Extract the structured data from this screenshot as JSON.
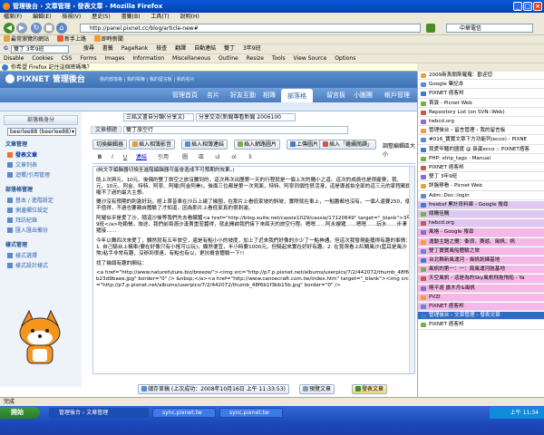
{
  "window": {
    "title": "管理後台 › 文章管理 › 發表文章 - Mozilla Firefox"
  },
  "menu": [
    "檔案(F)",
    "編輯(E)",
    "檢視(V)",
    "歷史(S)",
    "書籤(B)",
    "工具(T)",
    "說明(H)"
  ],
  "nav": {
    "url": "http://panel.pixnet.cc/blog/article-new#",
    "search_engine": "中華電信"
  },
  "bookmarks_toolbar": [
    "最常瀏覽的網站",
    "新手上路",
    "即時新聞"
  ],
  "google_toolbar": {
    "search": "雙丁 3年9班",
    "items": [
      "搜尋",
      "書籤",
      "PageRank",
      "檢查",
      "翻譯",
      "自動連結",
      "雙丁",
      "3年9班"
    ]
  },
  "webdev_toolbar": [
    "Disable",
    "Cookies",
    "CSS",
    "Forms",
    "Images",
    "Information",
    "Miscellaneous",
    "Outline",
    "Resize",
    "Tools",
    "View Source",
    "Options"
  ],
  "notification": "你希望 Firefox 記住這個密碼嗎？",
  "pixnet": {
    "logo": "PIXNET 管理後台",
    "toplinks": "我的部落格 | 我的相簿 | 我的留言板 | 我的名片",
    "tabs": [
      "管理首頁",
      "名片",
      "好友互動",
      "相簿",
      "部落格",
      "留言板",
      "小圖團",
      "帳戶管理"
    ],
    "active_tab": "部落格"
  },
  "sidebar": {
    "title1": "部落格身分",
    "user": "beerlee88 (beerlee88)",
    "section1": "文章管理",
    "items1": [
      "發表文章",
      "文章列表",
      "迴響/引用管理"
    ],
    "section2": "部落格管理",
    "items2": [
      "基本 / 進階設定",
      "側邊欄位設定",
      "拜訪紀錄",
      "匯入匯出備份"
    ],
    "section3": "樣式管理",
    "items3": [
      "樣式選擇",
      "樣式設計樣式"
    ]
  },
  "form": {
    "category_value": "三銘文書自分類(分享文)",
    "category2_value": "分享交流(新聞專看新聞 2006100",
    "title_label": "文章標題",
    "title_value": "雙丁旅空行",
    "btn_switch": "切換編輯器",
    "btn_insert_album": "插入相簿影音",
    "btn_insert_link": "插入相簿連結",
    "btn_insert_image": "插入網路圖片",
    "btn_upload": "上傳圖片",
    "btn_insert_more": "插入「繼續閱讀」",
    "layout_label": "調整編輯區大小",
    "editor_tabs": [
      "B",
      "I",
      "U",
      "連結",
      "引用",
      "圖",
      "區",
      "ul",
      "ol",
      "li"
    ],
    "active_editor_tab": "連結"
  },
  "editor_paragraphs": [
    "(純文字編輯器切換至進階編輯器可能會造成不可預期的效果。)",
    "既上次與元、10元、後偶的雙丁旅空之旅沒騰到的，這次再次出團第一天的行程就是一個上次的攤小之道。這次的成員也是很龐寮，我、元、10元、阿金、特特、阿寧、阿耀(阿金阿拳)，後面三位都是第一次見面，特特、阿寧同個性很活潑，這是導遊拍全部的這三元的家程都銳喔不了過的最大主想。",
    "攤沙沒有預期的刺激好玩，經上首昔車在沙丘上繞了幾圈，在那片上看低家坡的斜坡，實際就在車上，一點膽都也沒有。一個人還要250，便不值得，不過也要親自體驗了才知道，因為那片上看低家真的很刺激。",
    "阿耀似乎是愛了沙，隨道沙後等我們先去看餵蠶<a href=\"http://blog.xuite.net/cassie1029/cassie/17120649\" target=\"_blank\">3年9班</a>吃賴餐，旅途，我們前兩週沙漢賣重蒞蠶得，就此開啟我們接下來兩天的旅空行程。嗯嗯……阿永嫂猪……嗯嗯……玩水……步澤猪接……",
    "今年以舞四次來愛丁，麟然就有五年旅空，還是有點小小的坡度，加上了近來我們好像的沙少了一點神通。但這次我發現能獲得有趣的事情：1. 自己騎台上橫車(要在好像只有小搖可以玩)，顯然便宜，半小時要1000元，但騎起來實在好好有趣。2. 在寬灣看上紅鯛風沙(藍耳是風沙煞)粘手非常有趣，沒辦到很遠，有點也有以，更抗概會體驗一下!!",
    "找了幾個有趣的網站：",
    "<a href=\"http://www.naturefuture.biz/breeze/\"><img src=\"http://p7.p.pixnet.net/albums/userpics/7/2/442072/thumb_48f6b23d9baee.jpg\" border=\"0\" /> &nbsp;</a><a href=\"http://www.canoecraft.com.tw/index.htm\" target=\"_blank\"><img src=\"http://p7.p.pixnet.net/albums/userpics/7/2/442072/thumb_48f6b1f3bb15b.jpg\" border=\"0\" />"
  ],
  "save": {
    "draft": "儲存草稿 (上次成功：2008年10月16日 上午 11:33:53)",
    "preview": "預覽文章",
    "publish": "發表文章"
  },
  "bookmarks_sidebar": [
    "2009新馬關斯羅羅：歡迎您",
    "Google 筆記本",
    "PIXNET 痞客邦",
    "首頁 - Picnet Web",
    "Repository List (on SVN::Web)",
    "twbcd.org",
    "管理後台 › 留言管理 › 我的留言板",
    "#016_寶寶文章下方功能列(ecco) - PIXNE",
    "我愛牢騷的國度 @ 長蘆ecco :: PIXNET痞客",
    "PHP: strip_tags - Manual",
    "PIXNET 痞客邦",
    "雙丁 3年9班",
    "詳盤察看 - Picnet Web",
    "Adm::Doc::login",
    "freebsf 累計資料庫 - Google 搜尋",
    "總購佳購",
    "twbcd.org",
    "風格 - Google 搜尋",
    "運動主題之攤：衝浪、賽遊、風帆、帆",
    "雙丁寶寶風船體驗之旅",
    "台北縣新風運河 - 風帆訓練基地",
    "風帆的第一：一：兩風運河航基地",
    "天空風帆 - 這是為的Sky風帆飛拖飛船 - Ya",
    "略平遊 露木舟&風帆",
    "PVZI",
    "PIXNET 痞客邦",
    "管理後台 › 文章管理 › 發表文章",
    "PIXNET 痞客邦"
  ],
  "selected_bookmark": "管理後台 › 文章管理 › 發表文章",
  "status": "完成",
  "taskbar": {
    "start": "開始",
    "tasks": [
      "管理後台 › 文章管理",
      "sync.pixnet.tw",
      "sync.pixnet.tw"
    ],
    "clock": "上午 11:34"
  }
}
